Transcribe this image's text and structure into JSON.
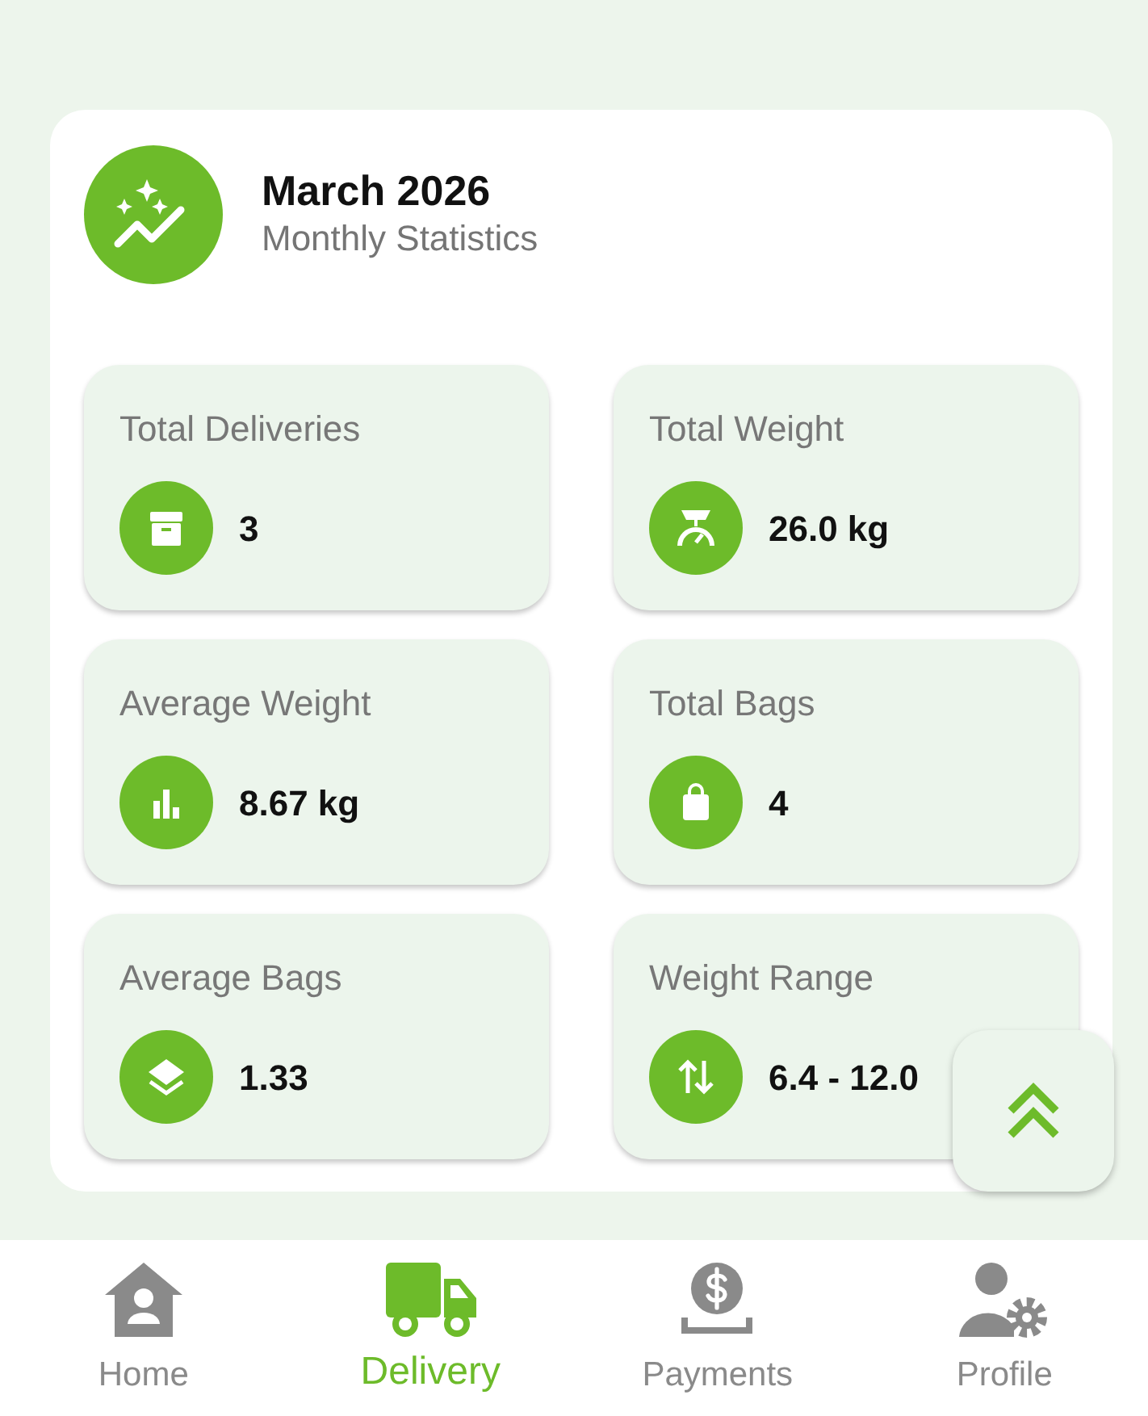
{
  "header": {
    "title": "March 2026",
    "subtitle": "Monthly Statistics"
  },
  "stats": [
    {
      "label": "Total Deliveries",
      "value": "3"
    },
    {
      "label": "Total Weight",
      "value": "26.0 kg"
    },
    {
      "label": "Average Weight",
      "value": "8.67 kg"
    },
    {
      "label": "Total Bags",
      "value": "4"
    },
    {
      "label": "Average Bags",
      "value": "1.33"
    },
    {
      "label": "Weight Range",
      "value": "6.4 - 12.0"
    }
  ],
  "bottom_nav": [
    {
      "label": "Home",
      "selected": false
    },
    {
      "label": "Delivery",
      "selected": true
    },
    {
      "label": "Payments",
      "selected": false
    },
    {
      "label": "Profile",
      "selected": false
    }
  ]
}
